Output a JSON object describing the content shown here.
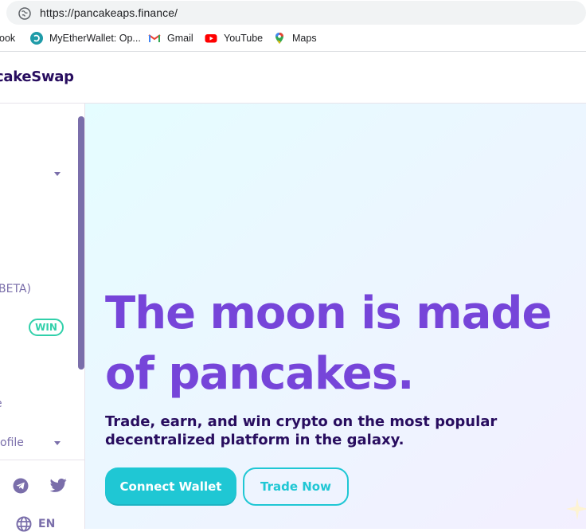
{
  "browser": {
    "url": "https://pancakeaps.finance/",
    "bookmarks": [
      {
        "label": "ook",
        "icon": "facebook-icon"
      },
      {
        "label": "MyEtherWallet: Op...",
        "icon": "myetherwallet-icon"
      },
      {
        "label": "Gmail",
        "icon": "gmail-icon"
      },
      {
        "label": "YouTube",
        "icon": "youtube-icon"
      },
      {
        "label": "Maps",
        "icon": "maps-icon"
      }
    ]
  },
  "header": {
    "logo_text": "cakeSwap"
  },
  "sidebar": {
    "items": [
      {
        "label": "BETA)"
      },
      {
        "label": "e"
      },
      {
        "label": "ofile"
      }
    ],
    "win_badge": "WIN",
    "language": "EN",
    "social_icons": [
      "telegram-icon",
      "twitter-icon"
    ],
    "language_icon": "globe-icon"
  },
  "hero": {
    "title_line1": "The moon is made",
    "title_line2": "of pancakes.",
    "subtitle_line1": "Trade, earn, and win crypto on the most popular",
    "subtitle_line2": "decentralized platform in the galaxy.",
    "connect_label": "Connect Wallet",
    "trade_label": "Trade Now"
  },
  "colors": {
    "primary": "#1fc7d4",
    "secondary": "#7645d9",
    "text": "#280d5f",
    "text_subtle": "#7a6eaa",
    "success": "#31d0aa"
  }
}
